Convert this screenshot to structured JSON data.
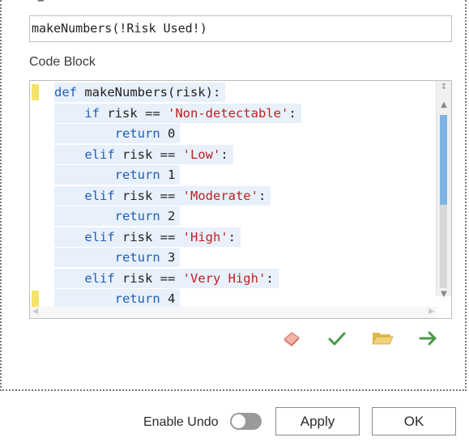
{
  "top_stub": "=",
  "expression": {
    "value": "makeNumbers(!Risk Used!)"
  },
  "code_block": {
    "label": "Code Block",
    "lines": [
      {
        "parts": [
          {
            "t": "kw",
            "v": "def"
          },
          {
            "t": "txt",
            "v": " makeNumbers(risk):"
          }
        ]
      },
      {
        "parts": [
          {
            "t": "kw",
            "v": "    if"
          },
          {
            "t": "txt",
            "v": " risk == "
          },
          {
            "t": "str",
            "v": "'Non-detectable'"
          },
          {
            "t": "txt",
            "v": ":"
          }
        ]
      },
      {
        "parts": [
          {
            "t": "kw",
            "v": "        return"
          },
          {
            "t": "txt",
            "v": " 0"
          }
        ]
      },
      {
        "parts": [
          {
            "t": "kw",
            "v": "    elif"
          },
          {
            "t": "txt",
            "v": " risk == "
          },
          {
            "t": "str",
            "v": "'Low'"
          },
          {
            "t": "txt",
            "v": ":"
          }
        ]
      },
      {
        "parts": [
          {
            "t": "kw",
            "v": "        return"
          },
          {
            "t": "txt",
            "v": " 1"
          }
        ]
      },
      {
        "parts": [
          {
            "t": "kw",
            "v": "    elif"
          },
          {
            "t": "txt",
            "v": " risk == "
          },
          {
            "t": "str",
            "v": "'Moderate'"
          },
          {
            "t": "txt",
            "v": ":"
          }
        ]
      },
      {
        "parts": [
          {
            "t": "kw",
            "v": "        return"
          },
          {
            "t": "txt",
            "v": " 2"
          }
        ]
      },
      {
        "parts": [
          {
            "t": "kw",
            "v": "    elif"
          },
          {
            "t": "txt",
            "v": " risk == "
          },
          {
            "t": "str",
            "v": "'High'"
          },
          {
            "t": "txt",
            "v": ":"
          }
        ]
      },
      {
        "parts": [
          {
            "t": "kw",
            "v": "        return"
          },
          {
            "t": "txt",
            "v": " 3"
          }
        ]
      },
      {
        "parts": [
          {
            "t": "kw",
            "v": "    elif"
          },
          {
            "t": "txt",
            "v": " risk == "
          },
          {
            "t": "str",
            "v": "'Very High'"
          },
          {
            "t": "txt",
            "v": ":"
          }
        ]
      },
      {
        "parts": [
          {
            "t": "kw",
            "v": "        return"
          },
          {
            "t": "txt",
            "v": " 4"
          }
        ]
      }
    ],
    "marked_lines": [
      0,
      10
    ]
  },
  "toolbar": {
    "icons": [
      "eraser-icon",
      "checkmark-icon",
      "open-folder-icon",
      "arrow-right-icon"
    ]
  },
  "footer": {
    "enable_undo_label": "Enable Undo",
    "enable_undo_on": false,
    "apply_label": "Apply",
    "ok_label": "OK"
  },
  "colors": {
    "keyword": "#1f5fb5",
    "string": "#c0201e",
    "line_highlight": "#e8f0fb",
    "marker": "#f4e36a",
    "scroll_thumb": "#7fb3e3",
    "check": "#4a9a4a",
    "folder": "#e2b84a",
    "arrow": "#4a9a4a",
    "eraser": "#e08a7a"
  }
}
